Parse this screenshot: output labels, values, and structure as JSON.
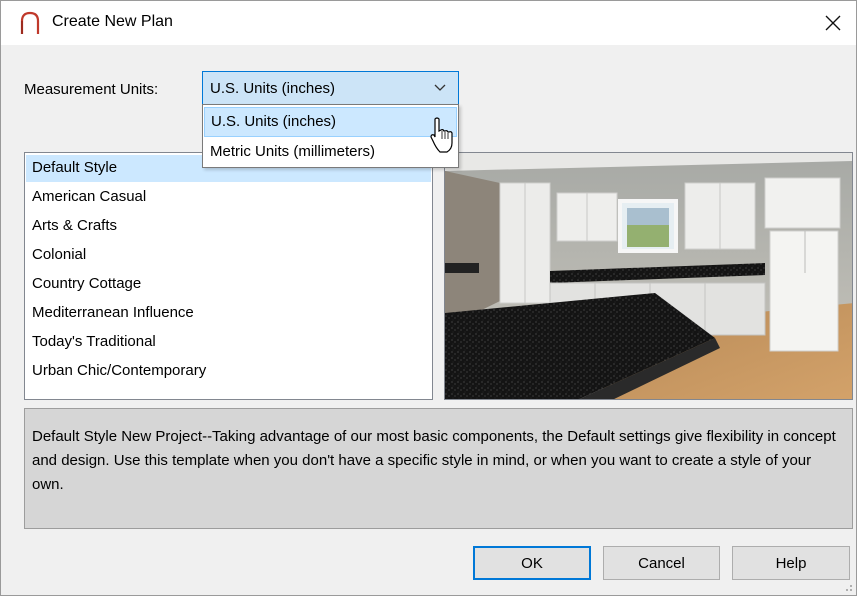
{
  "window": {
    "title": "Create New Plan",
    "close_icon": "close-icon",
    "app_icon": "arch-icon"
  },
  "units": {
    "label": "Measurement Units:",
    "selected": "U.S. Units (inches)",
    "options": [
      "U.S. Units (inches)",
      "Metric Units (millimeters)"
    ],
    "highlighted_index": 0
  },
  "styles": {
    "selected_index": 0,
    "items": [
      "Default Style",
      "American Casual",
      "Arts & Crafts",
      "Colonial",
      "Country Cottage",
      "Mediterranean Influence",
      "Today's Traditional",
      "Urban Chic/Contemporary"
    ]
  },
  "preview": {
    "subject": "kitchen-preview-image"
  },
  "description": "Default Style New Project--Taking advantage of our most basic components, the Default settings give flexibility in concept and design. Use this template when you don't have a specific style in mind, or when you want to create a style of your own.",
  "buttons": {
    "ok": "OK",
    "cancel": "Cancel",
    "help": "Help"
  },
  "colors": {
    "accent": "#0078d7",
    "dropdown_selected": "#cce8ff",
    "list_selected": "#cce8ff",
    "description_bg": "#d6d6d6",
    "app_icon": "#c0392b"
  }
}
